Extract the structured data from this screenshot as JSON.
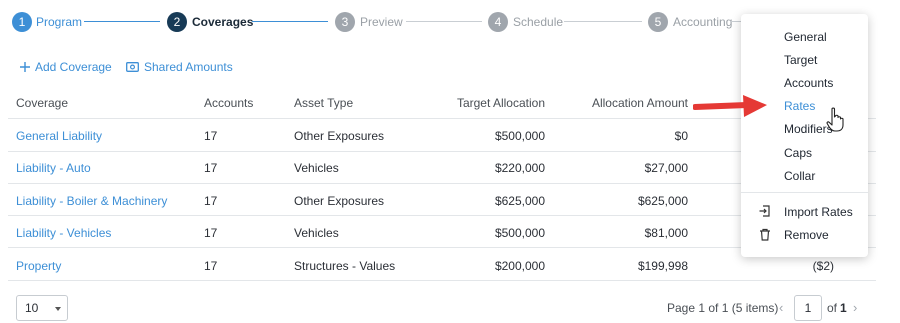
{
  "stepper": {
    "steps": [
      {
        "num": "1",
        "label": "Program"
      },
      {
        "num": "2",
        "label": "Coverages"
      },
      {
        "num": "3",
        "label": "Preview"
      },
      {
        "num": "4",
        "label": "Schedule"
      },
      {
        "num": "5",
        "label": "Accounting"
      }
    ]
  },
  "actions": {
    "add_coverage": "Add Coverage",
    "shared_amounts": "Shared Amounts"
  },
  "table": {
    "headers": [
      "Coverage",
      "Accounts",
      "Asset Type",
      "Target Allocation",
      "Allocation Amount"
    ],
    "rows": [
      {
        "coverage": "General Liability",
        "accounts": "17",
        "asset_type": "Other Exposures",
        "target": "$500,000",
        "allocation": "$0",
        "extra": ""
      },
      {
        "coverage": "Liability - Auto",
        "accounts": "17",
        "asset_type": "Vehicles",
        "target": "$220,000",
        "allocation": "$27,000",
        "extra": ""
      },
      {
        "coverage": "Liability - Boiler & Machinery",
        "accounts": "17",
        "asset_type": "Other Exposures",
        "target": "$625,000",
        "allocation": "$625,000",
        "extra": ""
      },
      {
        "coverage": "Liability - Vehicles",
        "accounts": "17",
        "asset_type": "Vehicles",
        "target": "$500,000",
        "allocation": "$81,000",
        "extra": ""
      },
      {
        "coverage": "Property",
        "accounts": "17",
        "asset_type": "Structures - Values",
        "target": "$200,000",
        "allocation": "$199,998",
        "extra": "($2)"
      }
    ]
  },
  "footer": {
    "page_size": "10",
    "page_info": "Page 1 of 1 (5 items)",
    "page_current": "1",
    "of_label": "of",
    "total_pages": "1"
  },
  "menu": {
    "items": [
      "General",
      "Target",
      "Accounts",
      "Rates",
      "Modifiers",
      "Caps",
      "Collar"
    ],
    "active": "Rates",
    "actions": [
      {
        "label": "Import Rates",
        "icon": "import-icon"
      },
      {
        "label": "Remove",
        "icon": "trash-icon"
      }
    ]
  },
  "colors": {
    "accent": "#3d8fd6",
    "active_step": "#173a56",
    "inactive_step": "#a0a6ad",
    "arrow": "#e53935"
  }
}
